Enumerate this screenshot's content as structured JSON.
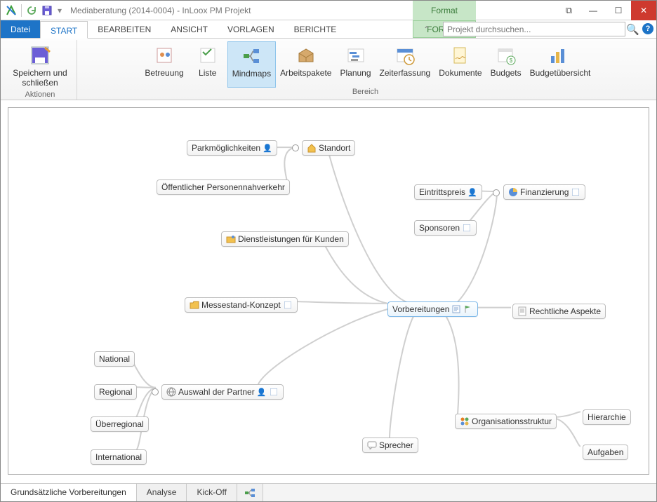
{
  "window": {
    "title": "Mediaberatung (2014-0004) - InLoox PM Projekt",
    "context_tab": "Format",
    "search_placeholder": "Projekt durchsuchen..."
  },
  "tabs": {
    "file": "Datei",
    "start": "START",
    "edit": "BEARBEITEN",
    "view": "ANSICHT",
    "templates": "VORLAGEN",
    "reports": "BERICHTE",
    "format": "FORMAT"
  },
  "ribbon": {
    "group_actions": "Aktionen",
    "group_area": "Bereich",
    "save_close": "Speichern und schließen",
    "betreuung": "Betreuung",
    "liste": "Liste",
    "mindmaps": "Mindmaps",
    "arbeitspakete": "Arbeitspakete",
    "planung": "Planung",
    "zeiterfassung": "Zeiterfassung",
    "dokumente": "Dokumente",
    "budgets": "Budgets",
    "budgetuebersicht": "Budgetübersicht"
  },
  "nodes": {
    "center": "Vorbereitungen",
    "standort": "Standort",
    "parkm": "Parkmöglichkeiten",
    "opnv": "Öffentlicher Personennahverkehr",
    "dienst": "Dienstleistungen für Kunden",
    "messe": "Messestand-Konzept",
    "eintritt": "Eintrittspreis",
    "sponsoren": "Sponsoren",
    "finanz": "Finanzierung",
    "recht": "Rechtliche Aspekte",
    "auswahl": "Auswahl der Partner",
    "national": "National",
    "regional": "Regional",
    "ueberregional": "Überregional",
    "international": "International",
    "sprecher": "Sprecher",
    "org": "Organisationsstruktur",
    "hierarchie": "Hierarchie",
    "aufgaben": "Aufgaben"
  },
  "bottom_tabs": {
    "grundsatz": "Grundsätzliche Vorbereitungen",
    "analyse": "Analyse",
    "kickoff": "Kick-Off"
  }
}
